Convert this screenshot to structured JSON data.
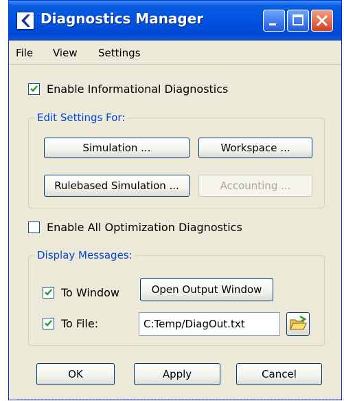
{
  "window": {
    "title": "Diagnostics Manager"
  },
  "menu": {
    "items": [
      "File",
      "View",
      "Settings"
    ]
  },
  "enable_informational": {
    "label": "Enable Informational Diagnostics",
    "checked": true
  },
  "edit_settings": {
    "legend": "Edit Settings For:",
    "simulation": "Simulation ...",
    "workspace": "Workspace ...",
    "rulebased": "Rulebased Simulation ...",
    "accounting": "Accounting ..."
  },
  "enable_optimization": {
    "label": "Enable All Optimization Diagnostics",
    "checked": false
  },
  "display_messages": {
    "legend": "Display Messages:",
    "to_window": {
      "label": "To Window",
      "checked": true
    },
    "open_output": "Open Output Window",
    "to_file": {
      "label": "To File:",
      "checked": true
    },
    "file_path": "C:Temp/DiagOut.txt"
  },
  "footer": {
    "ok": "OK",
    "apply": "Apply",
    "cancel": "Cancel"
  },
  "colors": {
    "titlebar": "#0053E1",
    "legend_text": "#0046D5",
    "window_bg": "#ECE9D8",
    "close_button": "#D1411F"
  },
  "icons": [
    "app-icon",
    "minimize-icon",
    "maximize-icon",
    "close-icon",
    "folder-open-icon"
  ]
}
